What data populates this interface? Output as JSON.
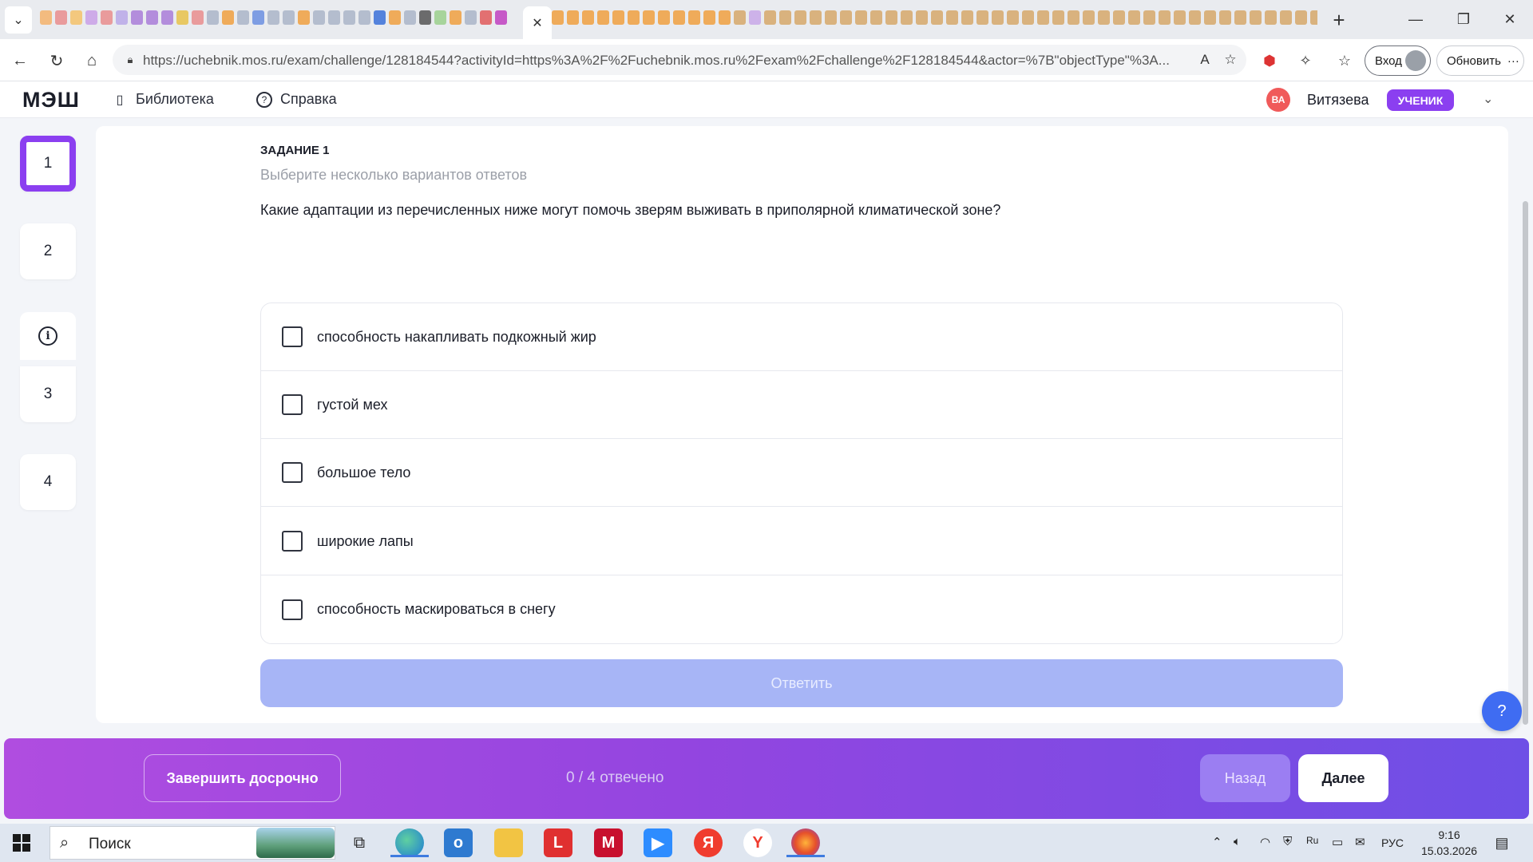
{
  "browser": {
    "url": "https://uchebnik.mos.ru/exam/challenge/128184544?activityId=https%3A%2F%2Fuchebnik.mos.ru%2Fexam%2Fchallenge%2F128184544&actor=%7B\"objectType\"%3A...",
    "signin_label": "Вход",
    "update_label": "Обновить",
    "tab_icon_colors": [
      "#f4b36b",
      "#e98d8d",
      "#f5c26a",
      "#c9a0e6",
      "#e98d8d",
      "#b9a8e8",
      "#a97cd8",
      "#a97cd8",
      "#a97cd8",
      "#e7c24a",
      "#e98d8d",
      "#aab5c8",
      "#f0a040",
      "#aab5c8",
      "#6b8fe0",
      "#aab5c8",
      "#aab5c8",
      "#f0a040",
      "#aab5c8",
      "#aab5c8",
      "#aab5c8",
      "#aab5c8",
      "#3a70d8",
      "#f0a040",
      "#aab5c8",
      "#555555",
      "#9bd08c",
      "#f0a040",
      "#aab5c8",
      "#e05a5a",
      "#c040c0",
      "#f0a040",
      "#f0a040",
      "#f0a040",
      "#f0a040",
      "#f0a040",
      "#f0a040",
      "#f0a040",
      "#f0a040",
      "#f0a040",
      "#f0a040",
      "#f0a040",
      "#f0a040",
      "#d6a86a",
      "#c8a8e8",
      "#d6a86a",
      "#d6a86a",
      "#d6a86a",
      "#d6a86a",
      "#d6a86a",
      "#d6a86a",
      "#d6a86a",
      "#d6a86a",
      "#d6a86a",
      "#d6a86a",
      "#d6a86a",
      "#d6a86a",
      "#d6a86a",
      "#d6a86a",
      "#d6a86a",
      "#d6a86a",
      "#d6a86a",
      "#d6a86a",
      "#d6a86a",
      "#d6a86a",
      "#d6a86a",
      "#d6a86a",
      "#d6a86a",
      "#d6a86a",
      "#d6a86a",
      "#d6a86a",
      "#d6a86a",
      "#d6a86a",
      "#d6a86a",
      "#d6a86a",
      "#d6a86a",
      "#d6a86a",
      "#d6a86a",
      "#d6a86a",
      "#d6a86a",
      "#d6a86a",
      "#d6a86a",
      "#d6a86a",
      "#d6a86a",
      "#d6a86a",
      "#d6a86a",
      "#d6a86a"
    ]
  },
  "header": {
    "logo": "МЭШ",
    "library_label": "Библиотека",
    "help_label": "Справка",
    "avatar_initials": "ВА",
    "user_name": "Витязева",
    "role_badge": "УЧЕНИК"
  },
  "question_nav": {
    "items": [
      "1",
      "2",
      "3",
      "4"
    ],
    "active": "1"
  },
  "task": {
    "title": "ЗАДАНИЕ 1",
    "hint": "Выберите несколько вариантов ответов",
    "question": "Какие адаптации из перечисленных ниже могут помочь зверям выживать в приполярной климатической зоне?",
    "options": [
      "способность накапливать подкожный жир",
      "густой мех",
      "большое тело",
      "широкие лапы",
      "способность маскироваться в снегу"
    ],
    "answer_label": "Ответить",
    "help_fab": "?"
  },
  "footer": {
    "finish_label": "Завершить досрочно",
    "progress": "0 / 4 отвечено",
    "back_label": "Назад",
    "next_label": "Далее"
  },
  "taskbar": {
    "search_label": "Поиск",
    "language": "РУС",
    "time": "9:16",
    "date": "15.03.2026"
  },
  "colors": {
    "accent": "#8b3ff0",
    "answer_button": "#a7b5f6",
    "bottom_bar_start": "#b04de0",
    "bottom_bar_end": "#6e4fe6"
  }
}
